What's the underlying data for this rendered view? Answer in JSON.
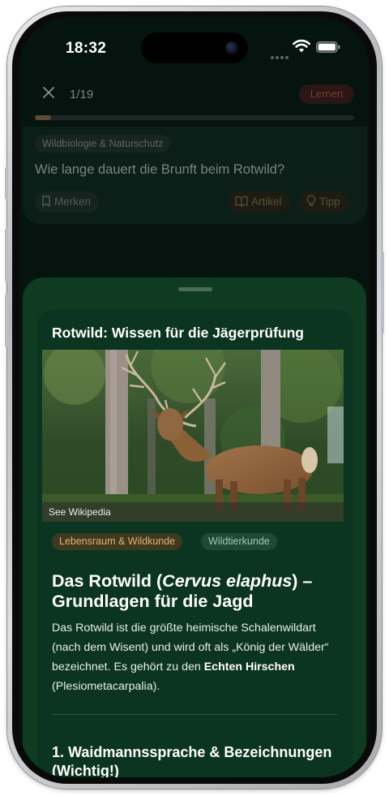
{
  "status_bar": {
    "time": "18:32"
  },
  "quiz": {
    "counter": "1/19",
    "learn_label": "Lernen",
    "progress": 0.05,
    "category": "Wildbiologie & Naturschutz",
    "question": "Wie lange dauert die Brunft beim Rotwild?",
    "bookmark_label": "Merken",
    "article_label": "Artikel",
    "hint_label": "Tipp"
  },
  "sheet": {
    "title": "Rotwild: Wissen für die Jägerprüfung",
    "image_caption": "See Wikipedia",
    "tags": [
      "Lebensraum & Wildkunde",
      "Wildtierkunde"
    ],
    "headline_prefix": "Das Rotwild (",
    "headline_italic": "Cervus elaphus",
    "headline_suffix": ") – Grundlagen für die Jagd",
    "body_part1": "Das Rotwild ist die größte heimische Schalenwildart (nach dem Wisent) und wird oft als „König der Wälder“ bezeichnet. Es gehört zu den ",
    "body_bold": "Echten Hirschen",
    "body_part2": " (Plesiometacarpalia).",
    "section_heading": "1. Waidmannssprache & Bezeichnungen (Wichtig!)"
  },
  "colors": {
    "sheet_bg": "#0e3b22",
    "accent_orange": "#e7b07a",
    "learn_red": "#7a3a32"
  }
}
